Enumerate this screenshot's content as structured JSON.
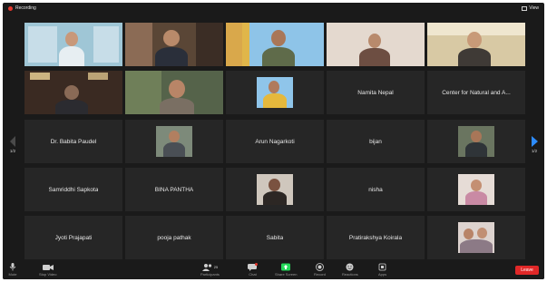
{
  "app": {
    "recording_label": "Recording",
    "view_label": "View"
  },
  "navigation": {
    "left_page": "1/2",
    "right_page": "1/2"
  },
  "participants": {
    "row1": [
      "",
      "",
      "",
      "",
      ""
    ],
    "row2": [
      "",
      "",
      "",
      "Namita Nepal",
      "Center for Natural and A..."
    ],
    "row3": [
      "Dr. Babita Paudel",
      "",
      "Arun Nagarkoti",
      "bijan",
      ""
    ],
    "row4": [
      "Samriddhi Sapkota",
      "BINA PANTHA",
      "",
      "nisha",
      ""
    ],
    "row5": [
      "Jyoti Prajapati",
      "pooja pathak",
      "Sabita",
      "Pratirakshya Koirala",
      ""
    ]
  },
  "toolbar": {
    "mute": "Mute",
    "start_video": "Stop Video",
    "participants": "Participants",
    "participant_count": "25",
    "chat": "Chat",
    "share_screen": "Share Screen",
    "record": "Record",
    "reactions": "Reactions",
    "apps": "Apps",
    "leave": "Leave"
  },
  "colors": {
    "background": "#1a1a1a",
    "tile": "#262626",
    "leave": "#e02828",
    "share": "#23d959",
    "nav_active": "#2d8cff"
  }
}
